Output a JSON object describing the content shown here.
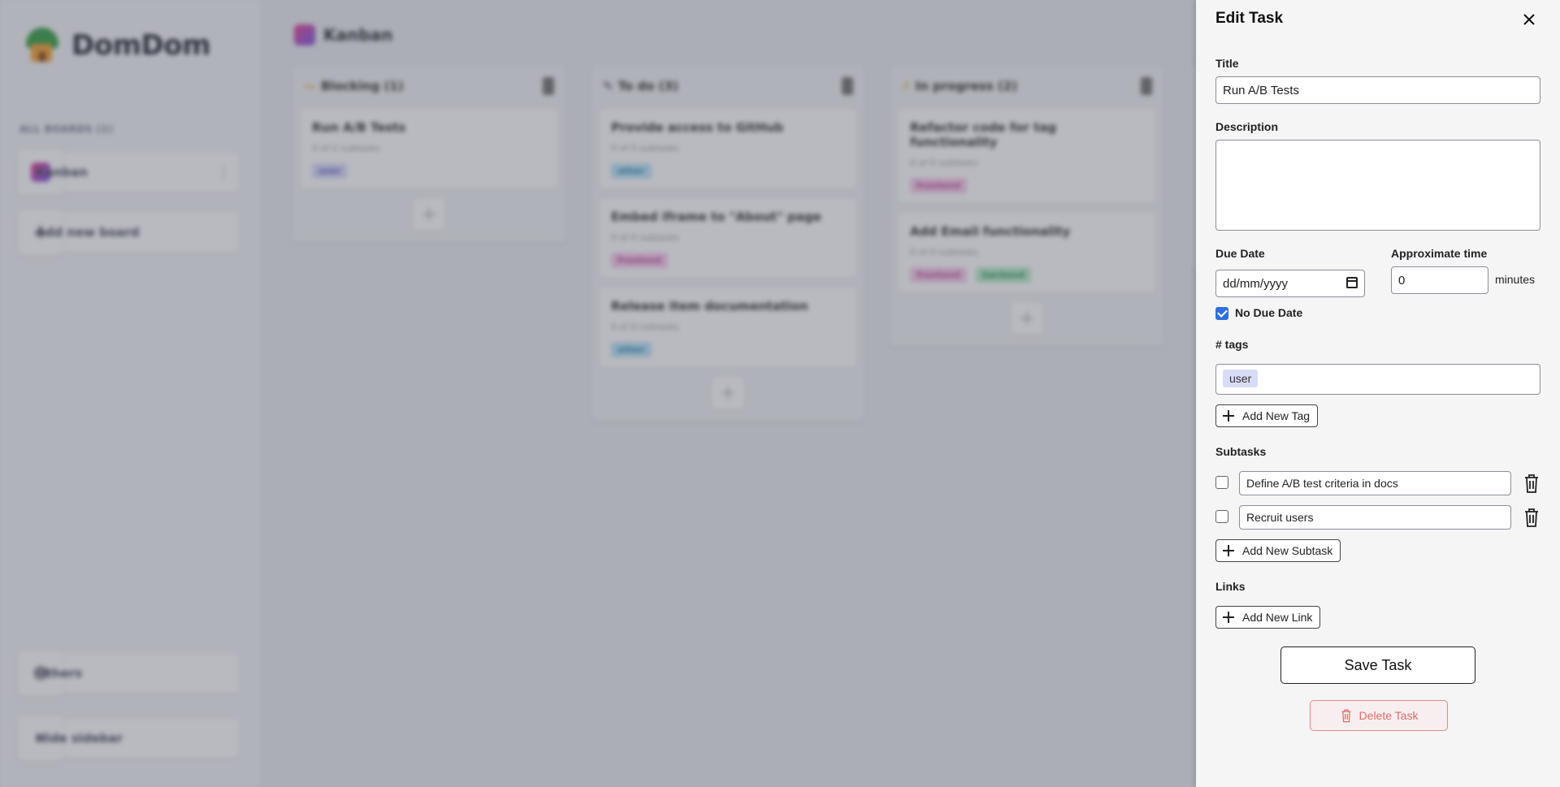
{
  "app": {
    "name": "DomDom",
    "board_section": "ALL BOARDS (1)",
    "boards": [
      {
        "label": "Kanban"
      }
    ],
    "add_board": "Add new board",
    "others": "Others",
    "hide_sidebar": "Hide sidebar"
  },
  "board": {
    "title": "Kanban",
    "columns": [
      {
        "title": "Blocking (1)",
        "cards": [
          {
            "title": "Run A/B Tests",
            "subtasks": "0 of 2 subtasks",
            "tags": [
              {
                "label": "user",
                "color": "#d9dcf7"
              }
            ]
          }
        ]
      },
      {
        "title": "To do (3)",
        "cards": [
          {
            "title": "Provide access to GitHub",
            "subtasks": "0 of 0 subtasks",
            "tags": [
              {
                "label": "other",
                "color": "#bfe6f7"
              }
            ]
          },
          {
            "title": "Embed iframe to \"About\" page",
            "subtasks": "0 of 0 subtasks",
            "tags": [
              {
                "label": "frontend",
                "color": "#f7cdea"
              }
            ]
          },
          {
            "title": "Release item documentation",
            "subtasks": "0 of 0 subtasks",
            "tags": [
              {
                "label": "other",
                "color": "#bfe6f7"
              }
            ]
          }
        ]
      },
      {
        "title": "In progress (2)",
        "cards": [
          {
            "title": "Refactor code for tag functionality",
            "subtasks": "0 of 0 subtasks",
            "tags": [
              {
                "label": "frontend",
                "color": "#f7cdea"
              }
            ]
          },
          {
            "title": "Add Email functionality",
            "subtasks": "0 of 0 subtasks",
            "tags": [
              {
                "label": "frontend",
                "color": "#f7cdea"
              },
              {
                "label": "backend",
                "color": "#bdeccd"
              }
            ]
          }
        ]
      }
    ]
  },
  "panel": {
    "title": "Edit Task",
    "title_label": "Title",
    "title_value": "Run A/B Tests",
    "description_label": "Description",
    "description_value": "",
    "due_date_label": "Due Date",
    "due_date_placeholder": "dd/mm/yyyy",
    "approx_time_label": "Approximate time",
    "approx_time_value": "0",
    "minutes_label": "minutes",
    "no_due_date_label": "No Due Date",
    "no_due_date_checked": true,
    "tags_label": "# tags",
    "tags": [
      {
        "label": "user"
      }
    ],
    "add_tag_label": "Add New Tag",
    "subtasks_label": "Subtasks",
    "subtasks": [
      {
        "text": "Define A/B test criteria in docs",
        "done": false
      },
      {
        "text": "Recruit users",
        "done": false
      }
    ],
    "add_subtask_label": "Add New Subtask",
    "links_label": "Links",
    "add_link_label": "Add New Link",
    "save_label": "Save Task",
    "delete_label": "Delete Task"
  }
}
